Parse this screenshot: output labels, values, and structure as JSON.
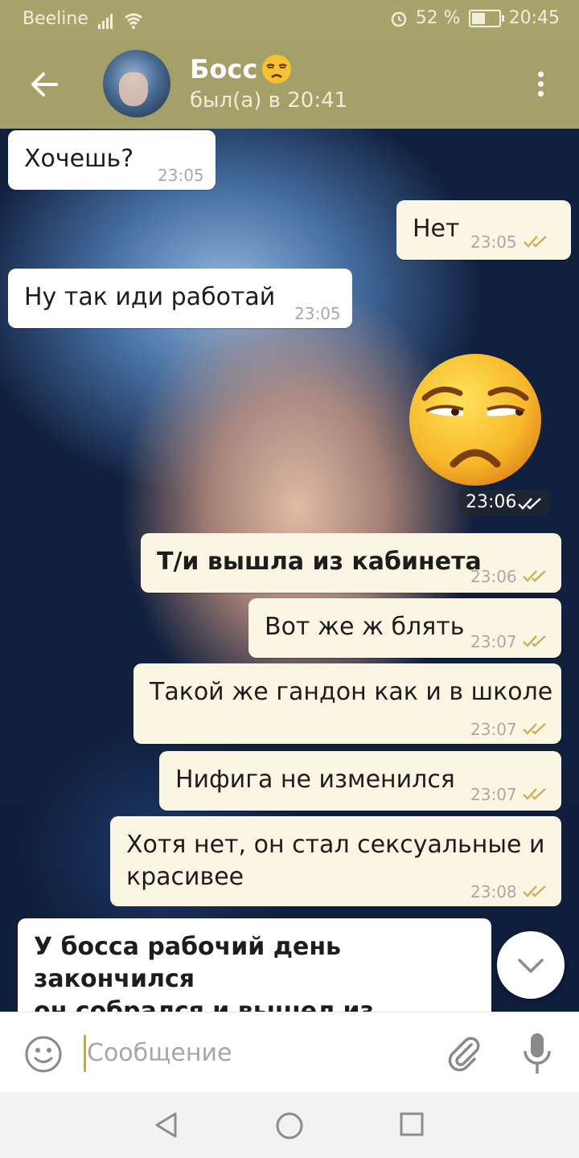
{
  "status_bar": {
    "carrier": "Beeline",
    "battery": "52 %",
    "battery_level": 0.52,
    "time": "20:45"
  },
  "header": {
    "title": "Босс",
    "title_emoji": "unamused-face-emoji",
    "subtitle": "был(а) в 20:41"
  },
  "messages": [
    {
      "dir": "in",
      "text": "Хочешь?",
      "time": "23:05"
    },
    {
      "dir": "out",
      "text": "Нет",
      "time": "23:05",
      "status": "read"
    },
    {
      "dir": "in",
      "text": "Ну так иди работай",
      "time": "23:05"
    },
    {
      "dir": "out",
      "sticker": "unamused-face-emoji",
      "time": "23:06",
      "status": "read"
    },
    {
      "dir": "out",
      "text": "Т/и вышла из кабинета",
      "time": "23:06",
      "status": "read",
      "bold": true
    },
    {
      "dir": "out",
      "text": "Вот же ж блять",
      "time": "23:07",
      "status": "read"
    },
    {
      "dir": "out",
      "text": "Такой же гандон как и в школе",
      "time": "23:07",
      "status": "read"
    },
    {
      "dir": "out",
      "text": "Нифига не изменился",
      "time": "23:07",
      "status": "read"
    },
    {
      "dir": "out",
      "text_lines": [
        "Хотя нет, он стал сексуальные и",
        "красивее"
      ],
      "time": "23:08",
      "status": "read"
    },
    {
      "dir": "in",
      "text_lines": [
        "У босса рабочий день закончился",
        "он собрался и вышел из кабинета"
      ],
      "bold": true
    }
  ],
  "input": {
    "placeholder": "Сообщение"
  },
  "colors": {
    "header": "#a5a06a",
    "status_bar": "#a8a36c",
    "outgoing_bubble": "#fbf6e3",
    "incoming_bubble": "#ffffff",
    "check": "#c9b35a"
  }
}
